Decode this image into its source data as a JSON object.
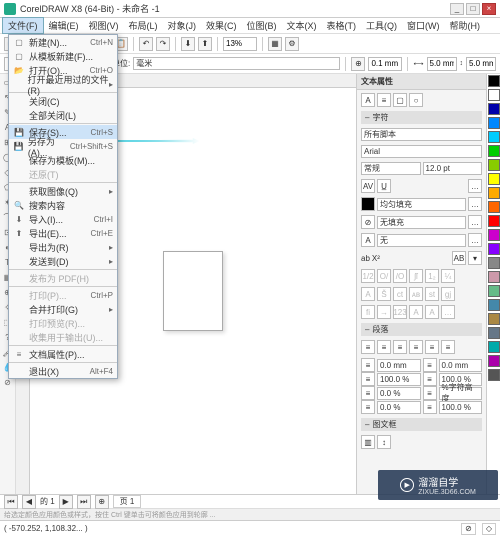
{
  "title": "CorelDRAW X8 (64-Bit) - 未命名 -1",
  "menubar": [
    "文件(F)",
    "编辑(E)",
    "视图(V)",
    "布局(L)",
    "对象(J)",
    "效果(C)",
    "位图(B)",
    "文本(X)",
    "表格(T)",
    "工具(Q)",
    "窗口(W)",
    "帮助(H)"
  ],
  "file_menu": [
    {
      "label": "新建(N)...",
      "sc": "Ctrl+N",
      "ic": "▢"
    },
    {
      "label": "从模板新建(F)...",
      "ic": "▢"
    },
    {
      "label": "打开(O)...",
      "sc": "Ctrl+O",
      "ic": "📂"
    },
    {
      "label": "打开最近用过的文件(R)",
      "sub": true
    },
    {
      "sep": true
    },
    {
      "label": "关闭(C)"
    },
    {
      "label": "全部关闭(L)"
    },
    {
      "sep": true
    },
    {
      "label": "保存(S)...",
      "sc": "Ctrl+S",
      "ic": "💾",
      "hi": true
    },
    {
      "label": "另存为(A)...",
      "sc": "Ctrl+Shift+S",
      "ic": "💾"
    },
    {
      "label": "保存为模板(M)..."
    },
    {
      "label": "还原(T)",
      "dis": true
    },
    {
      "sep": true
    },
    {
      "label": "获取图像(Q)",
      "sub": true
    },
    {
      "label": "搜索内容",
      "ic": "🔍"
    },
    {
      "label": "导入(I)...",
      "sc": "Ctrl+I",
      "ic": "⬇"
    },
    {
      "label": "导出(E)...",
      "sc": "Ctrl+E",
      "ic": "⬆"
    },
    {
      "label": "导出为(R)",
      "sub": true
    },
    {
      "label": "发送到(D)",
      "sub": true
    },
    {
      "sep": true
    },
    {
      "label": "发布为 PDF(H)",
      "dis": true
    },
    {
      "sep": true
    },
    {
      "label": "打印(P)...",
      "sc": "Ctrl+P",
      "dis": true
    },
    {
      "label": "合并打印(G)",
      "sub": true
    },
    {
      "label": "打印预览(R)...",
      "dis": true
    },
    {
      "label": "收集用于输出(U)...",
      "dis": true
    },
    {
      "sep": true
    },
    {
      "label": "文档属性(P)...",
      "ic": "≡"
    },
    {
      "sep": true
    },
    {
      "label": "退出(X)",
      "sc": "Alt+F4"
    }
  ],
  "toolbar1": {
    "zoom": "13%"
  },
  "toolbar2": {
    "unit_label": "单位:",
    "unit": "毫米",
    "nudge": "0.1 mm",
    "dx": "5.0 mm",
    "dy": "5.0 mm"
  },
  "right": {
    "panel_title": "文本属性",
    "sections": {
      "char": "字符",
      "para": "段落",
      "frame": "图文框"
    },
    "script": "所有脚本",
    "font": "Arial",
    "weight": "常规",
    "size": "12.0 pt",
    "fill_label": "均匀填充",
    "outline_label": "无填充",
    "none_label": "无",
    "row_inputs": [
      "0.0 mm",
      "0.0 mm",
      "100.0 %",
      "100.0 %",
      "0.0 %",
      "%字符高度",
      "0.0 %",
      "100.0 %"
    ]
  },
  "tabs": {
    "page_of": "的 1",
    "page_label": "页 1"
  },
  "hint": "给选定颜色应用颜色或样式，按住 Ctrl 键单击可将颜色应用到轮廓 ...",
  "status": {
    "coords": "( -570.252, 1,108.32... )"
  },
  "watermark": {
    "brand": "溜溜自学",
    "url": "ZIXUE.3D66.COM"
  },
  "swatches": [
    "#000",
    "#fff",
    "#00a",
    "#08f",
    "#0cf",
    "#0c0",
    "#8c0",
    "#ff0",
    "#fa0",
    "#f60",
    "#f00",
    "#c0c",
    "#80f",
    "#888",
    "#c9a",
    "#6b8",
    "#48a",
    "#a84",
    "#678",
    "#0aa",
    "#a0a",
    "#555"
  ]
}
